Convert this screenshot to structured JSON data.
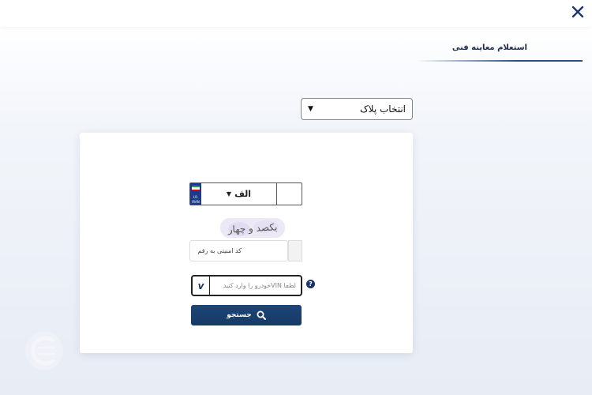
{
  "header": {
    "close_icon": "close-icon"
  },
  "tabs": [
    {
      "label": "استعلام معاینه فنی",
      "active": true
    }
  ],
  "plate_type_select": {
    "selected": "انتخاب پلاک"
  },
  "plate": {
    "country_text_line1": "I.R.",
    "country_text_line2": "IRAN",
    "letter": "الف"
  },
  "captcha": {
    "image_text": "یکصد و چهار",
    "placeholder": "کد امنیتی به رقم"
  },
  "vin": {
    "icon_letter": "v",
    "placeholder": "لطفا VINخودرو را وارد کنید",
    "help_label": "?"
  },
  "search_button": {
    "label": "جستجو"
  },
  "colors": {
    "primary": "#1a3468",
    "button": "#1d4575",
    "accent_line": "#2b4f82"
  }
}
